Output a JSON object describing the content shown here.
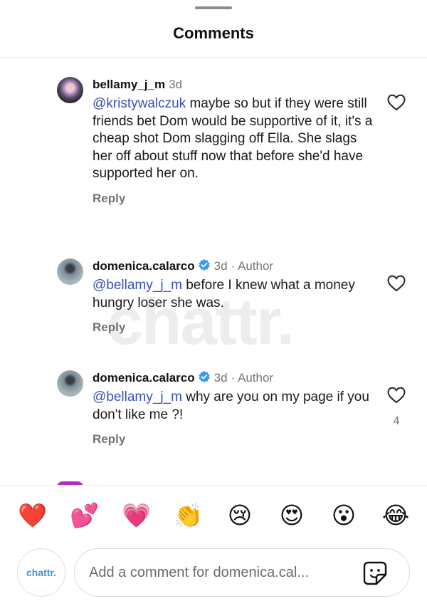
{
  "header": {
    "title": "Comments"
  },
  "watermark": "chattr.",
  "comments": [
    {
      "username": "bellamy_j_m",
      "time": "3d",
      "meta": "",
      "verified": false,
      "mention": "@kristywalczuk",
      "text": " maybe so but if they were still friends bet Dom would be supportive of it, it's a cheap shot Dom slagging off Ella. She slags her off about stuff now that before she'd have supported her on.",
      "reply_label": "Reply",
      "likes": ""
    },
    {
      "username": "domenica.calarco",
      "time": "3d",
      "meta": "· Author",
      "verified": true,
      "mention": "@bellamy_j_m",
      "text": " before I knew what a money hungry loser she was.",
      "reply_label": "Reply",
      "likes": ""
    },
    {
      "username": "domenica.calarco",
      "time": "3d",
      "meta": "· Author",
      "verified": true,
      "mention": "@bellamy_j_m",
      "text": " why are you on my page if you don't like me ?!",
      "reply_label": "Reply",
      "likes": "4"
    }
  ],
  "reactions": [
    "❤️",
    "💕",
    "💗",
    "👏",
    "😢",
    "😍",
    "😮",
    "😂"
  ],
  "reaction_icons": [
    "red-heart-icon",
    "two-hearts-icon",
    "growing-heart-icon",
    "clapping-hands-icon",
    "crying-face-icon",
    "heart-eyes-face-icon",
    "open-mouth-face-icon",
    "tears-of-joy-face-icon"
  ],
  "composer": {
    "avatar_label": "chattr.",
    "placeholder": "Add a comment for domenica.cal...",
    "value": ""
  },
  "colors": {
    "mention": "#3b4fb8",
    "verified": "#3897f0",
    "muted": "#737373"
  }
}
